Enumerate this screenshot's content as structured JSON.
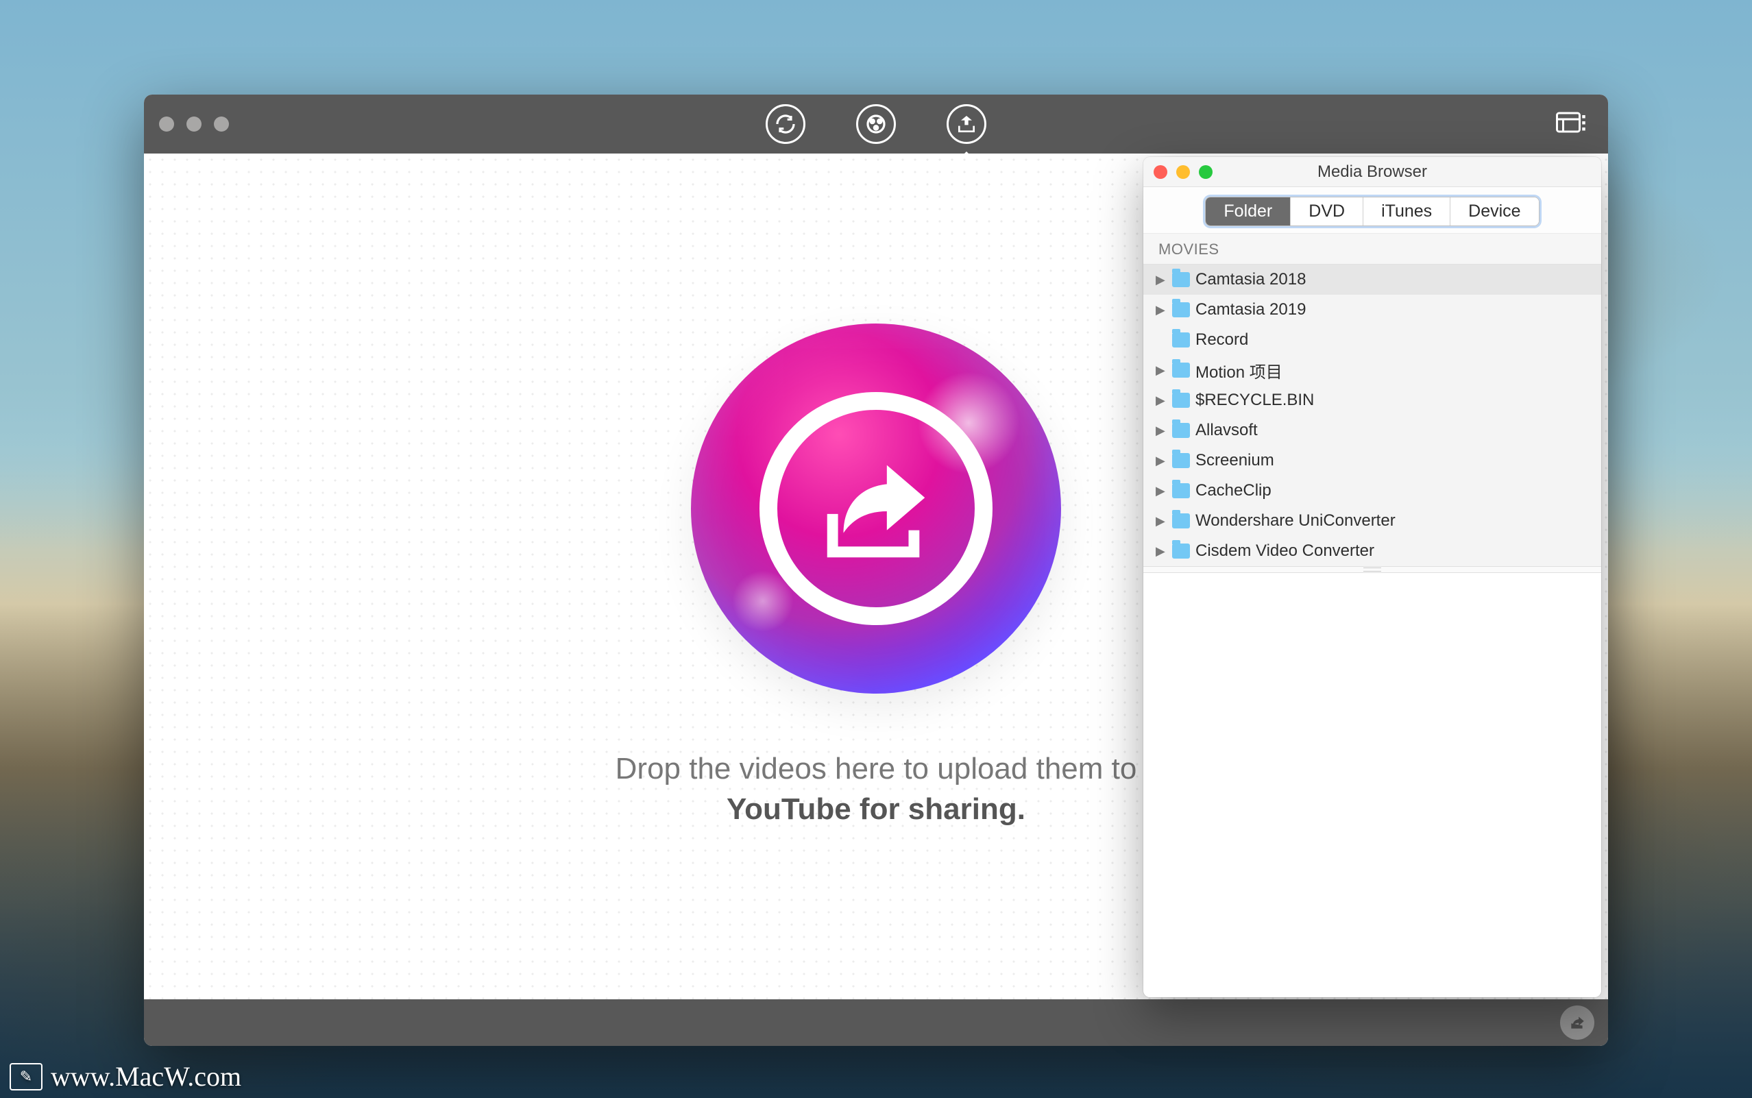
{
  "main_window": {
    "toolbar": {
      "icons": [
        "convert-icon",
        "video-icon",
        "share-icon"
      ],
      "active": "share-icon",
      "right_icon": "media-panel-icon"
    },
    "drop_text_line1": "Drop the videos here to upload them to",
    "drop_text_line2": "YouTube for sharing."
  },
  "media_browser": {
    "title": "Media Browser",
    "tabs": [
      "Folder",
      "DVD",
      "iTunes",
      "Device"
    ],
    "active_tab": "Folder",
    "section_header": "MOVIES",
    "folders": [
      {
        "name": "Camtasia 2018",
        "expandable": true,
        "selected": true
      },
      {
        "name": "Camtasia 2019",
        "expandable": true
      },
      {
        "name": "Record",
        "expandable": false
      },
      {
        "name": "Motion 项目",
        "expandable": true
      },
      {
        "name": "$RECYCLE.BIN",
        "expandable": true
      },
      {
        "name": "Allavsoft",
        "expandable": true
      },
      {
        "name": "Screenium",
        "expandable": true
      },
      {
        "name": "CacheClip",
        "expandable": true
      },
      {
        "name": "Wondershare UniConverter",
        "expandable": true
      },
      {
        "name": "Cisdem Video Converter",
        "expandable": true
      }
    ]
  },
  "watermark": "www.MacW.com"
}
